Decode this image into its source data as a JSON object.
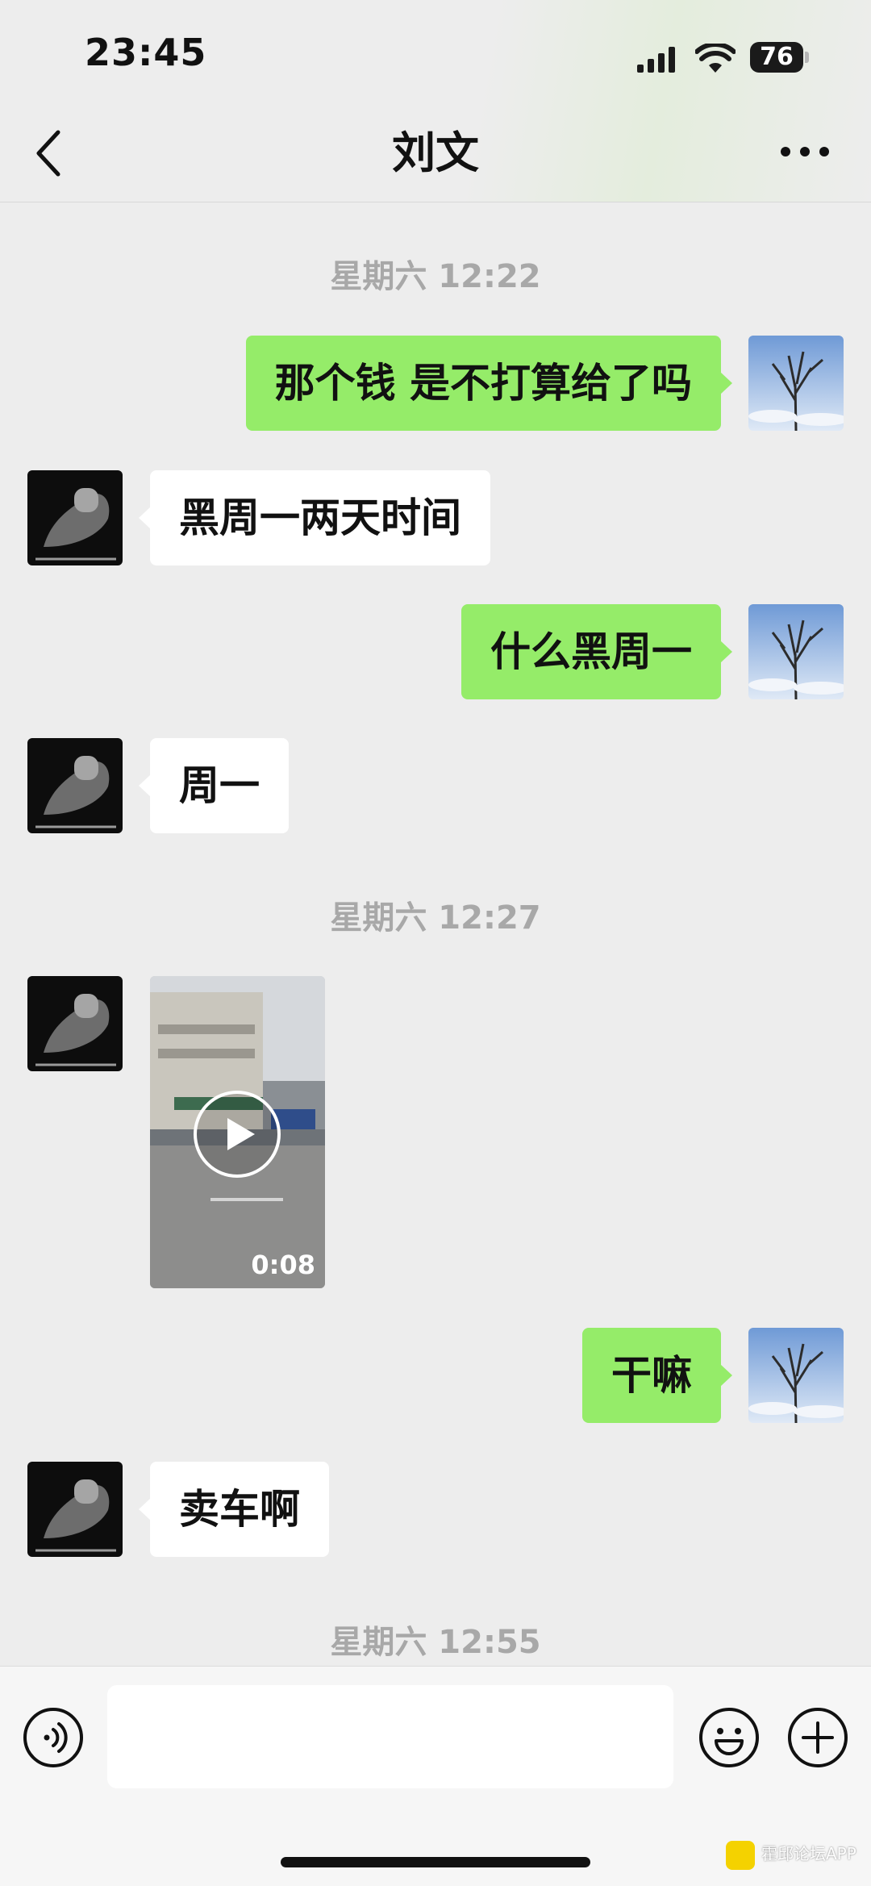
{
  "status": {
    "time": "23:45",
    "battery": "76"
  },
  "header": {
    "title": "刘文"
  },
  "timestamps": [
    "星期六 12:22",
    "星期六 12:27",
    "星期六 12:55"
  ],
  "messages": [
    {
      "from": "me",
      "text": "那个钱 是不打算给了吗"
    },
    {
      "from": "them",
      "text": "黑周一两天时间"
    },
    {
      "from": "me",
      "text": "什么黑周一"
    },
    {
      "from": "them",
      "text": "周一"
    },
    {
      "from": "them",
      "type": "video",
      "duration": "0:08"
    },
    {
      "from": "me",
      "text": "干嘛"
    },
    {
      "from": "them",
      "text": "卖车啊"
    }
  ],
  "watermark": {
    "text": "霍邱论坛APP"
  },
  "icons": {
    "back": "chevron-left-icon",
    "more": "more-dots-icon",
    "voice": "voice-icon",
    "emoji": "emoji-icon",
    "plus": "plus-icon",
    "play": "play-icon"
  },
  "colors": {
    "my_bubble": "#95ec69",
    "their_bubble": "#ffffff",
    "background": "#ededed"
  }
}
